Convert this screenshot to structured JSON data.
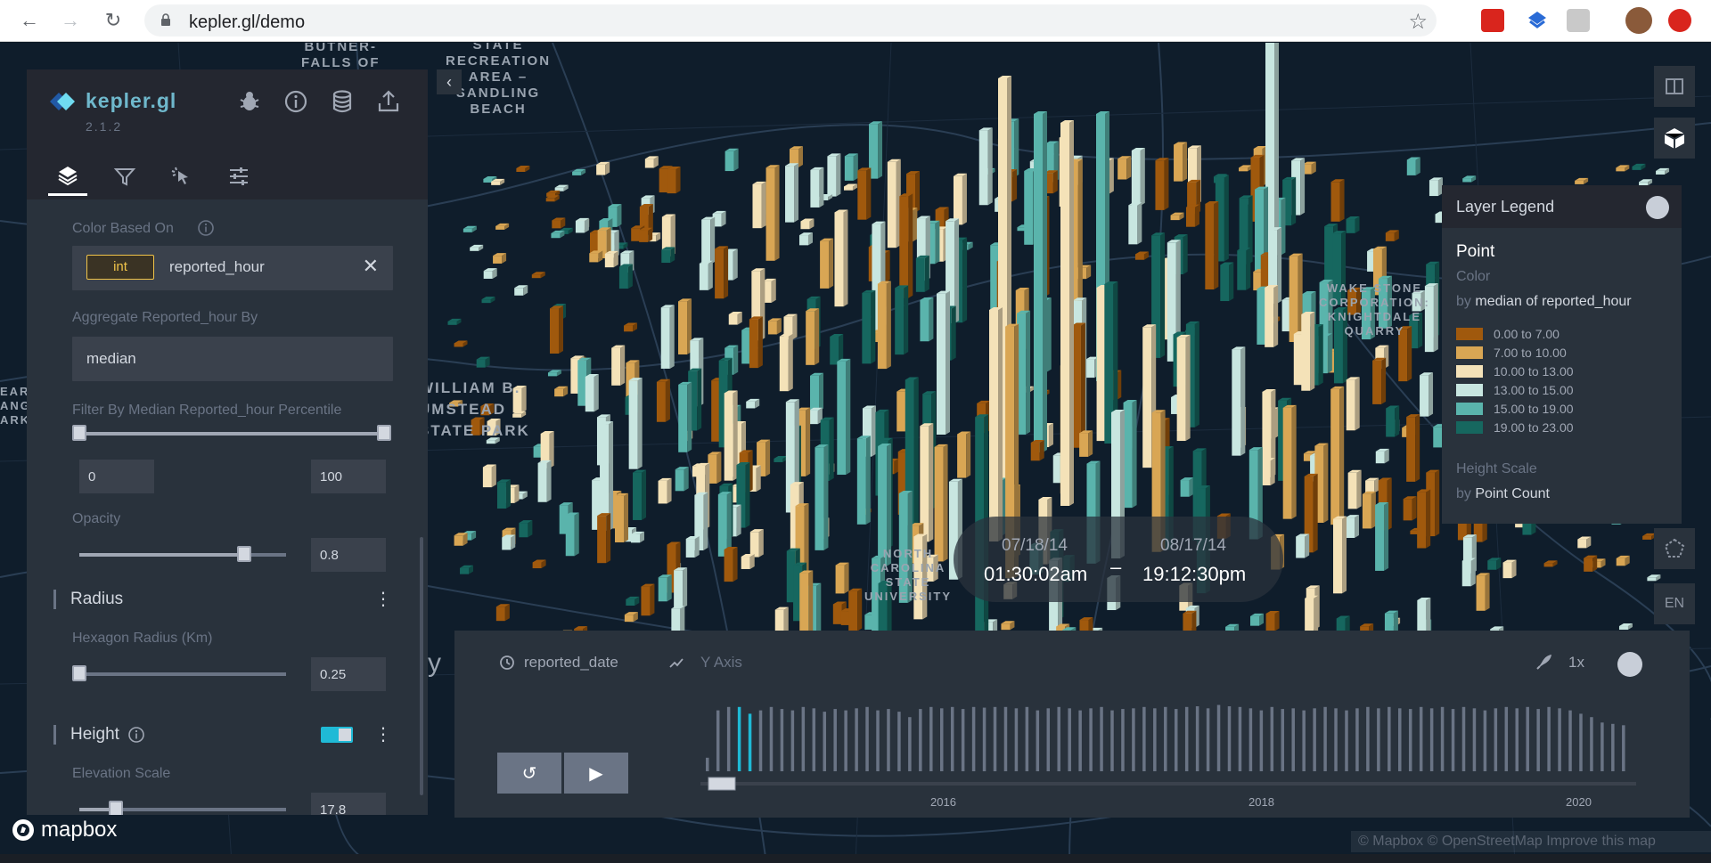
{
  "browser": {
    "url": "kepler.gl/demo"
  },
  "map_labels": {
    "butner": "BUTNER-\nFALLS OF",
    "falls_lake": "STATE\nRECREATION\nAREA –\nSANDLING\nBEACH",
    "wake_stone": "WAKE STONE\nCORPORATION:\nKNIGHTDALE\nQUARRY",
    "umstead": "WILLIAM B.\nUMSTEAD\nSTATE PARK",
    "ncsu": "NORTH\nCAROLINA\nSTATE\nUNIVERSITY",
    "left_edge": "EAR\nANG\nARK",
    "letter_y": "y"
  },
  "side_panel": {
    "app_name": "kepler.gl",
    "version": "2.1.2",
    "tabs": [
      "layers",
      "filters",
      "interactions",
      "map-style"
    ],
    "color_based_on_label": "Color Based On",
    "color_field_type": "int",
    "color_field_name": "reported_hour",
    "aggregate_label": "Aggregate Reported_hour By",
    "aggregate_value": "median",
    "filter_label": "Filter By Median Reported_hour Percentile",
    "filter_min": "0",
    "filter_max": "100",
    "opacity_label": "Opacity",
    "opacity_value": "0.8",
    "radius_section": "Radius",
    "hexagon_radius_label": "Hexagon Radius (Km)",
    "hexagon_radius_value": "0.25",
    "height_section": "Height",
    "elevation_label": "Elevation Scale",
    "elevation_value": "17.8"
  },
  "legend": {
    "title": "Layer Legend",
    "layer_type": "Point",
    "color_label": "Color",
    "color_by_prefix": "by",
    "color_by_field": "median of reported_hour",
    "bins": [
      {
        "label": "0.00 to 7.00",
        "color": "#a0590d"
      },
      {
        "label": "7.00 to 10.00",
        "color": "#d9a654"
      },
      {
        "label": "10.00 to 13.00",
        "color": "#f4e2b8"
      },
      {
        "label": "13.00 to 15.00",
        "color": "#c8e6e0"
      },
      {
        "label": "15.00 to 19.00",
        "color": "#5ab4ac"
      },
      {
        "label": "19.00 to 23.00",
        "color": "#16675f"
      }
    ],
    "height_label": "Height Scale",
    "height_by_prefix": "by",
    "height_by_field": "Point Count"
  },
  "time_range": {
    "start_date": "07/18/14",
    "start_time": "01:30:02am",
    "separator": "–",
    "end_date": "08/17/14",
    "end_time": "19:12:30pm"
  },
  "animation": {
    "field": "reported_date",
    "y_axis": "Y Axis",
    "speed": "1x",
    "years": [
      "2016",
      "2018",
      "2020"
    ],
    "histogram": [
      0.2,
      0.9,
      0.95,
      0.95,
      0.85,
      0.9,
      0.95,
      0.92,
      0.9,
      0.95,
      0.93,
      0.88,
      0.92,
      0.9,
      0.93,
      0.95,
      0.9,
      0.92,
      0.88,
      0.8,
      0.92,
      0.95,
      0.93,
      0.95,
      0.92,
      0.95,
      0.94,
      0.95,
      0.95,
      0.93,
      0.95,
      0.9,
      0.93,
      0.95,
      0.93,
      0.9,
      0.93,
      0.95,
      0.9,
      0.92,
      0.93,
      0.95,
      0.93,
      0.95,
      0.92,
      0.95,
      0.96,
      0.93,
      0.98,
      0.96,
      0.95,
      0.93,
      0.9,
      0.95,
      0.92,
      0.93,
      0.9,
      0.93,
      0.95,
      0.93,
      0.9,
      0.93,
      0.95,
      0.93,
      0.95,
      0.93,
      0.92,
      0.95,
      0.93,
      0.95,
      0.92,
      0.95,
      0.93,
      0.9,
      0.93,
      0.95,
      0.93,
      0.95,
      0.92,
      0.95,
      0.93,
      0.9,
      0.85,
      0.8,
      0.72,
      0.7,
      0.68
    ]
  },
  "map_controls": {
    "locale": "EN"
  },
  "attribution": "© Mapbox © OpenStreetMap  Improve this map",
  "mapbox_logo": "mapbox"
}
